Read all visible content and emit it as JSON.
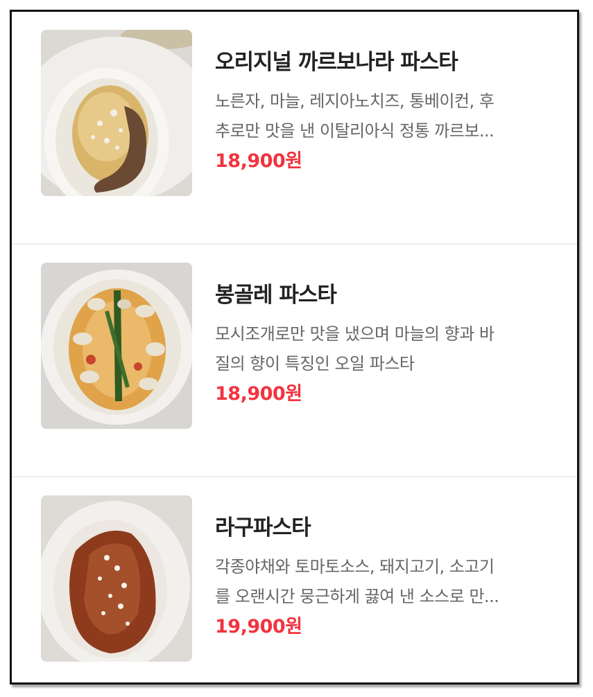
{
  "menu": {
    "items": [
      {
        "name": "오리지널 까르보나라 파스타",
        "description_line1": "노른자, 마늘, 레지아노치즈, 통베이컨, 후",
        "description_line2": "추로만 맛을 낸 이탈리아식 정통 까르보...",
        "price": "18,900원",
        "image_icon": "carbonara-photo-icon"
      },
      {
        "name": "봉골레 파스타",
        "description_line1": "모시조개로만 맛을 냈으며 마늘의 향과 바",
        "description_line2": "질의 향이 특징인 오일 파스타",
        "price": "18,900원",
        "image_icon": "vongole-photo-icon"
      },
      {
        "name": "라구파스타",
        "description_line1": "각종야채와 토마토소스, 돼지고기, 소고기",
        "description_line2": "를 오랜시간 뭉근하게 끓여 낸 소스로 만...",
        "price": "19,900원",
        "image_icon": "ragu-photo-icon"
      }
    ]
  },
  "colors": {
    "price": "#f2343f",
    "name": "#222222",
    "description": "#666666",
    "divider": "#ececec"
  }
}
